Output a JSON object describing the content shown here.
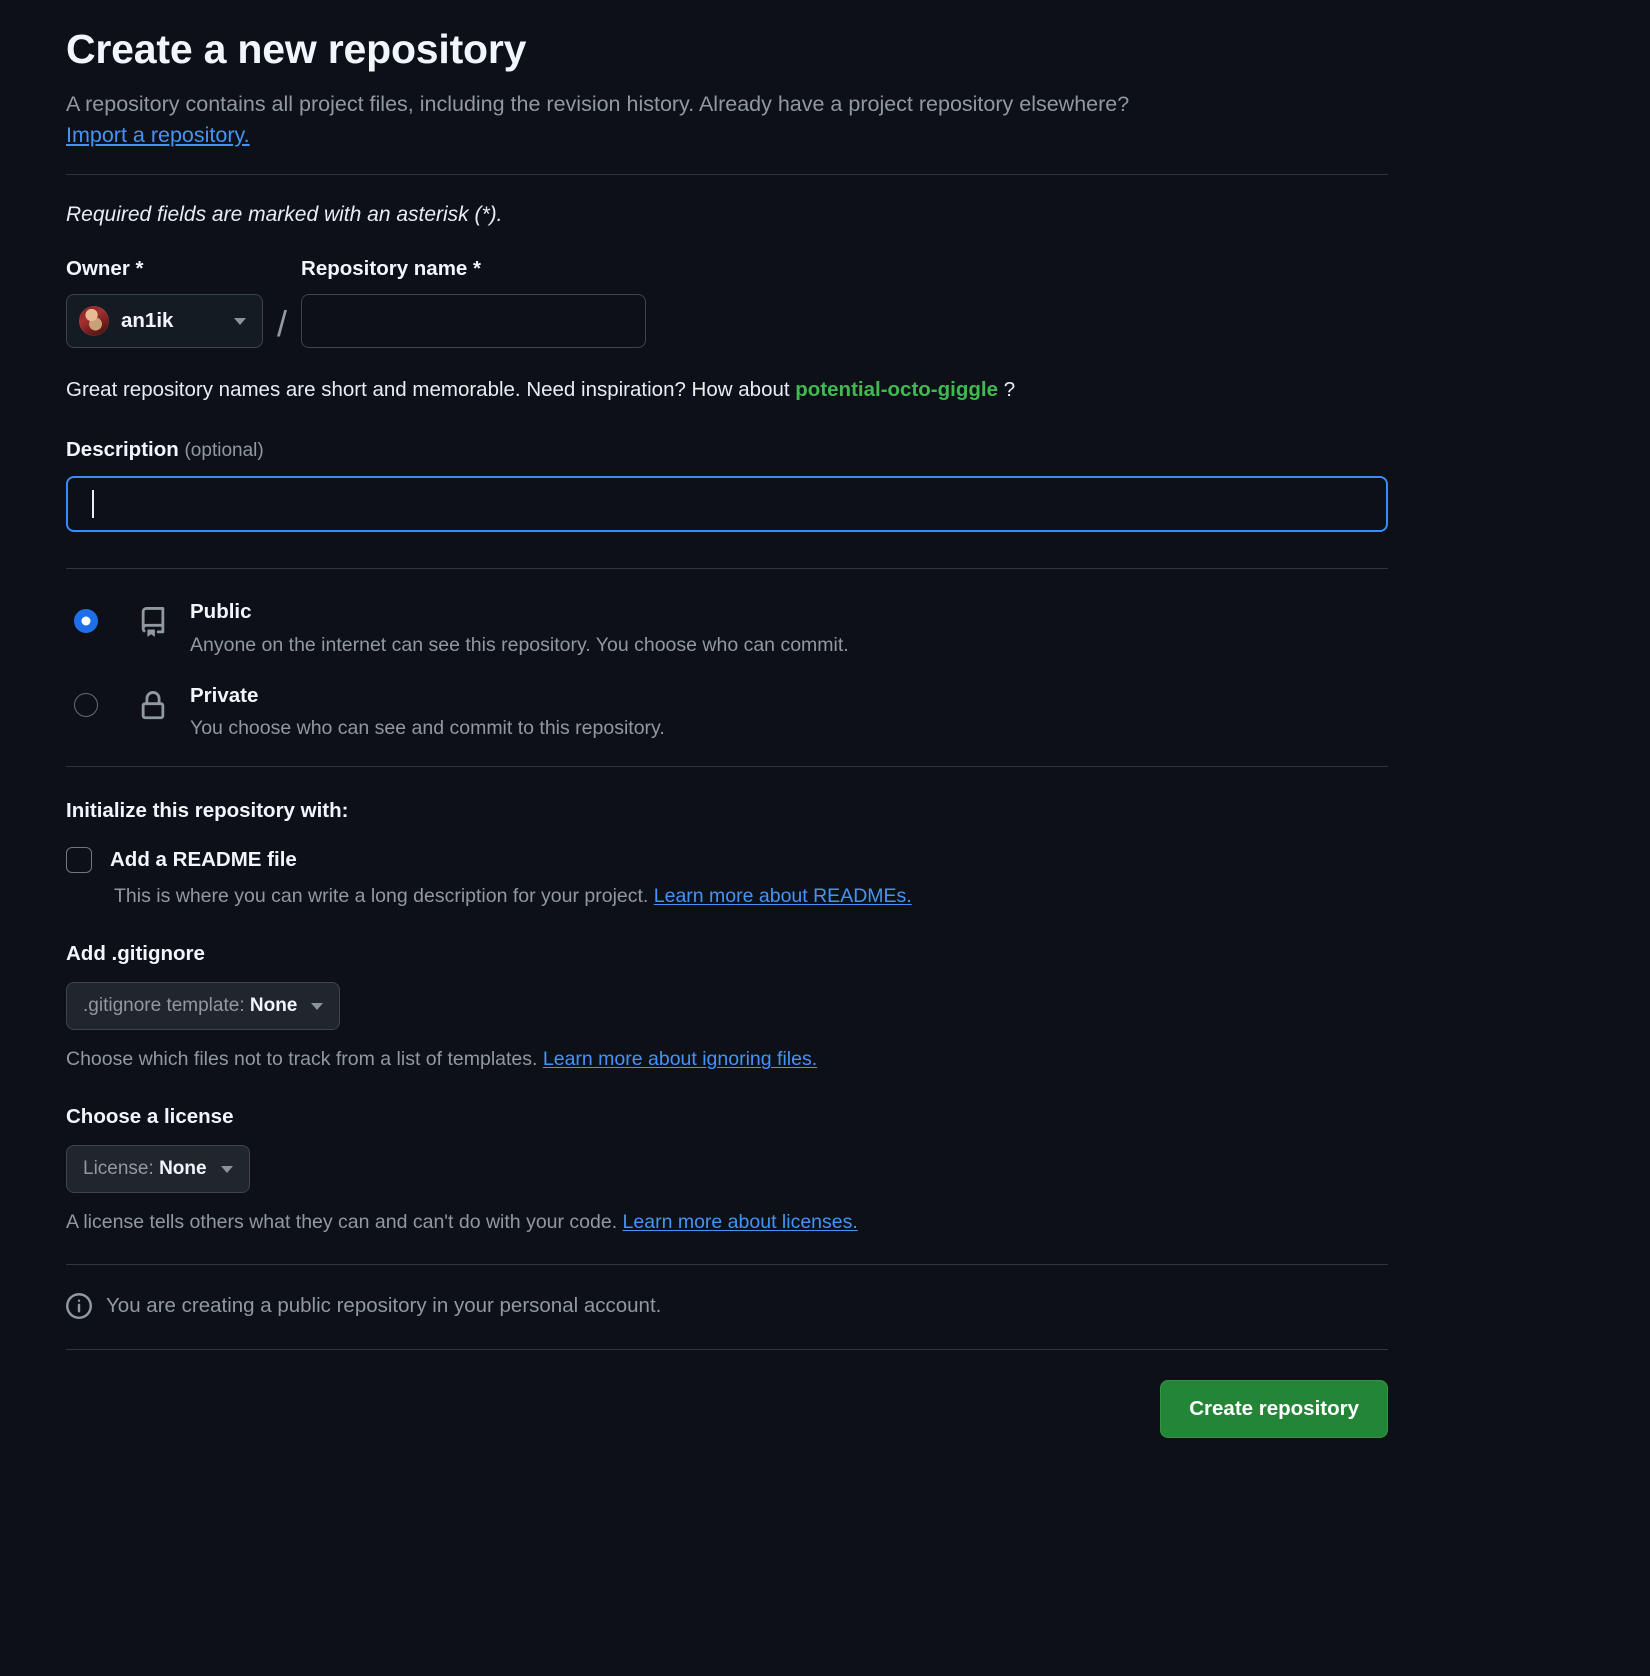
{
  "page": {
    "title": "Create a new repository",
    "lede_text": "A repository contains all project files, including the revision history. Already have a project repository elsewhere?",
    "import_link": "Import a repository.",
    "required_note": "Required fields are marked with an asterisk (*)."
  },
  "owner": {
    "label": "Owner *",
    "name": "an1ik",
    "separator": "/"
  },
  "repository_name": {
    "label": "Repository name *",
    "value": "",
    "placeholder": ""
  },
  "suggestion": {
    "prefix": "Great repository names are short and memorable. Need inspiration? How about",
    "name": "potential-octo-giggle",
    "suffix": "?",
    "color": "#3fb950"
  },
  "description": {
    "label": "Description",
    "optional": "(optional)",
    "value": "",
    "placeholder": "",
    "focused": true,
    "focus_color": "#388bfd"
  },
  "visibility": {
    "options": [
      {
        "id": "public",
        "title": "Public",
        "subtitle": "Anyone on the internet can see this repository. You choose who can commit.",
        "selected": true,
        "icon": "repo-icon"
      },
      {
        "id": "private",
        "title": "Private",
        "subtitle": "You choose who can see and commit to this repository.",
        "selected": false,
        "icon": "lock-icon"
      }
    ]
  },
  "initialize": {
    "heading": "Initialize this repository with:",
    "readme": {
      "label": "Add a README file",
      "checked": false,
      "help_text": "This is where you can write a long description for your project.",
      "help_link": "Learn more about READMEs."
    }
  },
  "gitignore": {
    "heading": "Add .gitignore",
    "select_prefix": ".gitignore template:",
    "select_value": "None",
    "help_text": "Choose which files not to track from a list of templates.",
    "help_link": "Learn more about ignoring files."
  },
  "license": {
    "heading": "Choose a license",
    "select_prefix": "License:",
    "select_value": "None",
    "help_text": "A license tells others what they can and can't do with your code.",
    "help_link": "Learn more about licenses."
  },
  "notice": {
    "icon": "info-icon",
    "text": "You are creating a public repository in your personal account."
  },
  "actions": {
    "create_label": "Create repository",
    "create_color": "#238636"
  }
}
